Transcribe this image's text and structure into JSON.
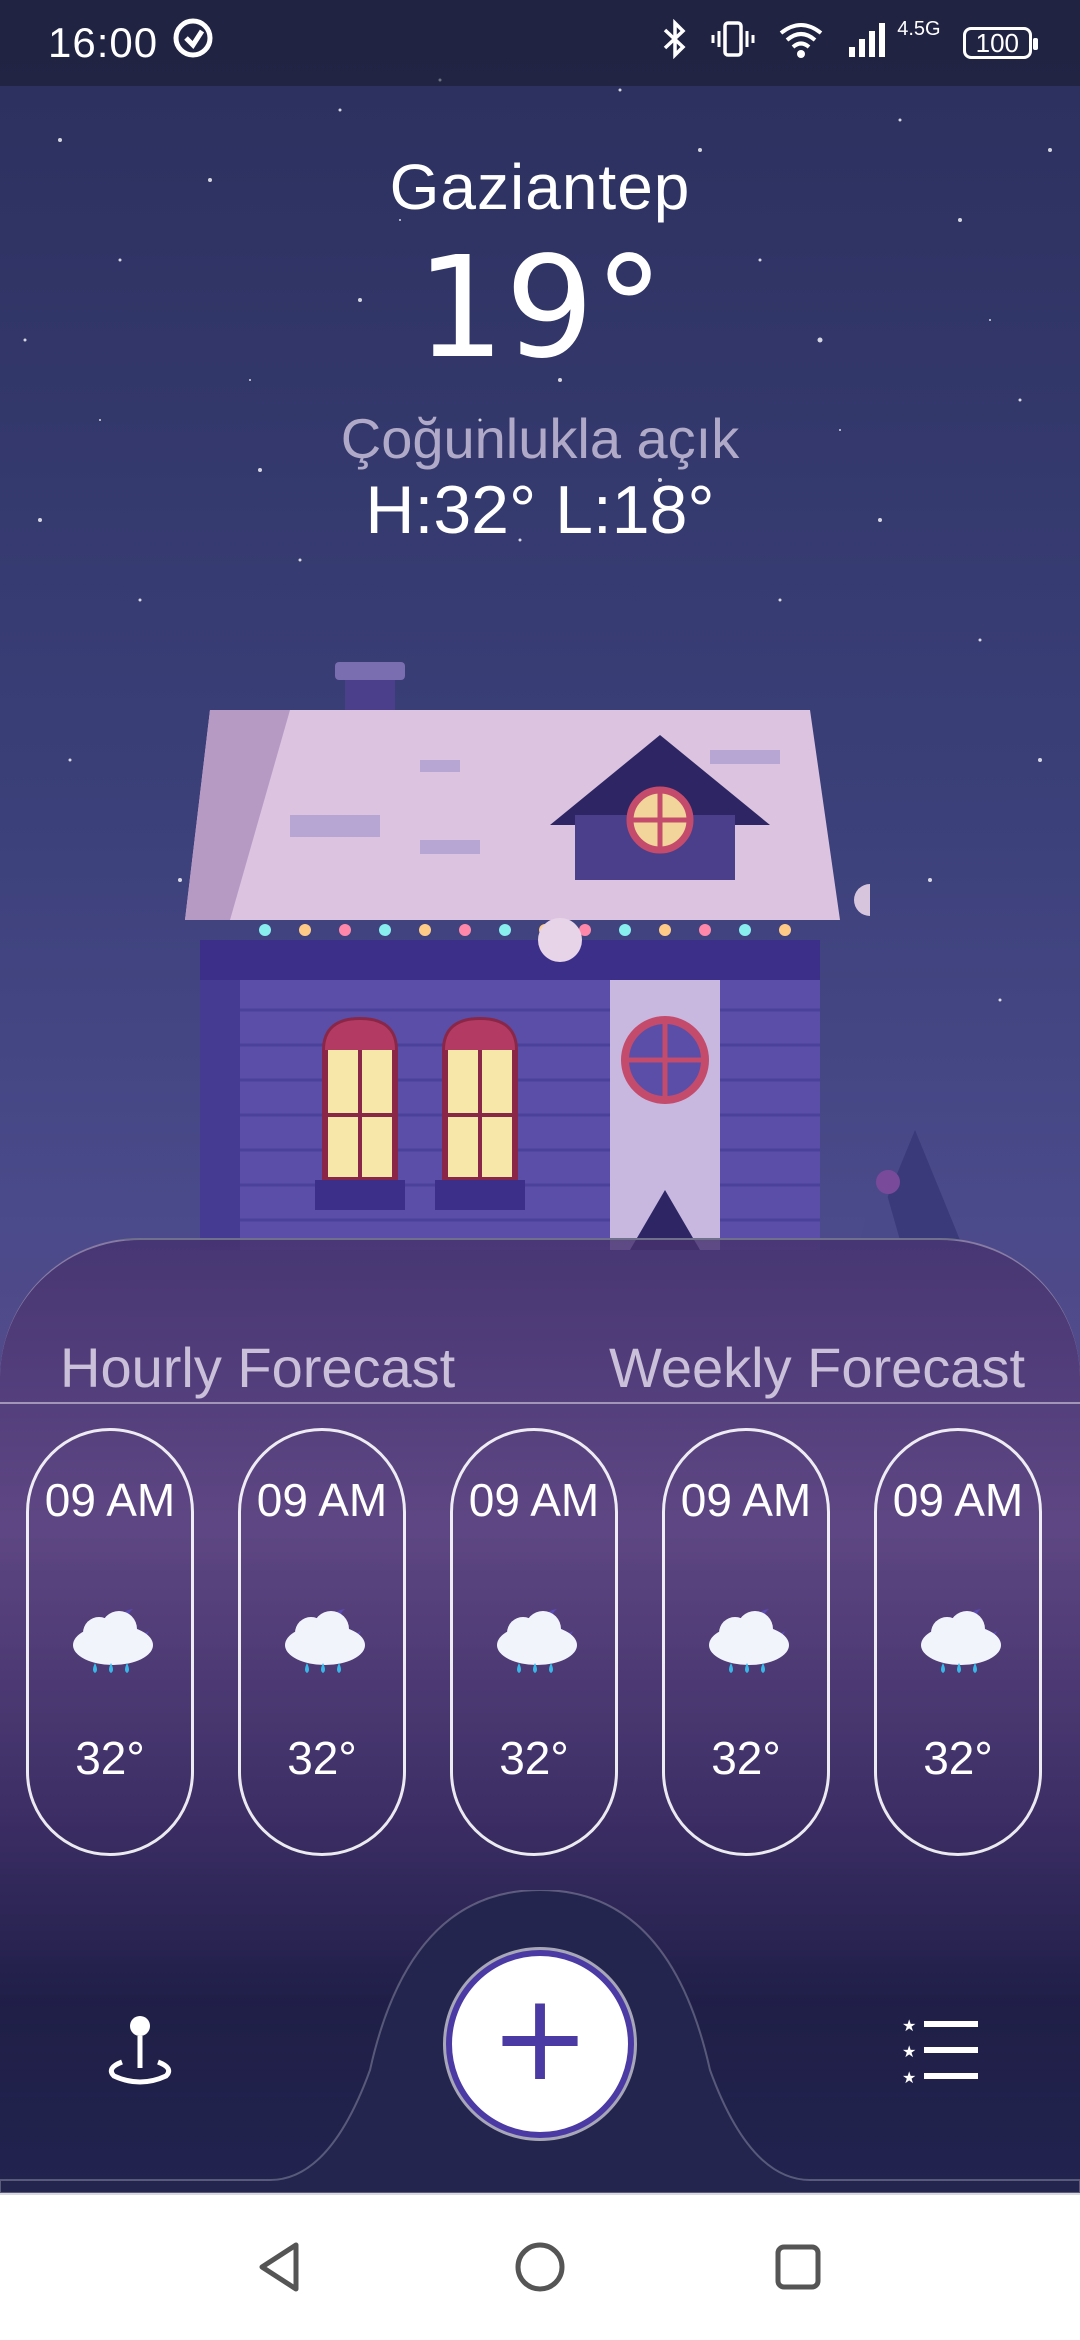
{
  "status_bar": {
    "time": "16:00",
    "network": "4.5G",
    "battery": "100"
  },
  "weather": {
    "city": "Gaziantep",
    "temperature": "19°",
    "condition": "Çoğunlukla açık",
    "high_low": "H:32° L:18°"
  },
  "tabs": {
    "hourly": "Hourly Forecast",
    "weekly": "Weekly Forecast"
  },
  "hourly": [
    {
      "time": "09 AM",
      "temp": "32°",
      "icon": "night-cloud-rain-icon"
    },
    {
      "time": "09 AM",
      "temp": "32°",
      "icon": "night-cloud-rain-icon"
    },
    {
      "time": "09 AM",
      "temp": "32°",
      "icon": "night-cloud-rain-icon"
    },
    {
      "time": "09 AM",
      "temp": "32°",
      "icon": "night-cloud-rain-icon"
    },
    {
      "time": "09 AM",
      "temp": "32°",
      "icon": "night-cloud-rain-icon"
    }
  ],
  "bottom_nav": {
    "left_icon": "location-pin-icon",
    "center_icon": "plus-icon",
    "right_icon": "starred-list-icon"
  },
  "colors": {
    "accent": "#4b3aa3",
    "sky_top": "#2b2f5c",
    "sheet": "#22244f"
  }
}
